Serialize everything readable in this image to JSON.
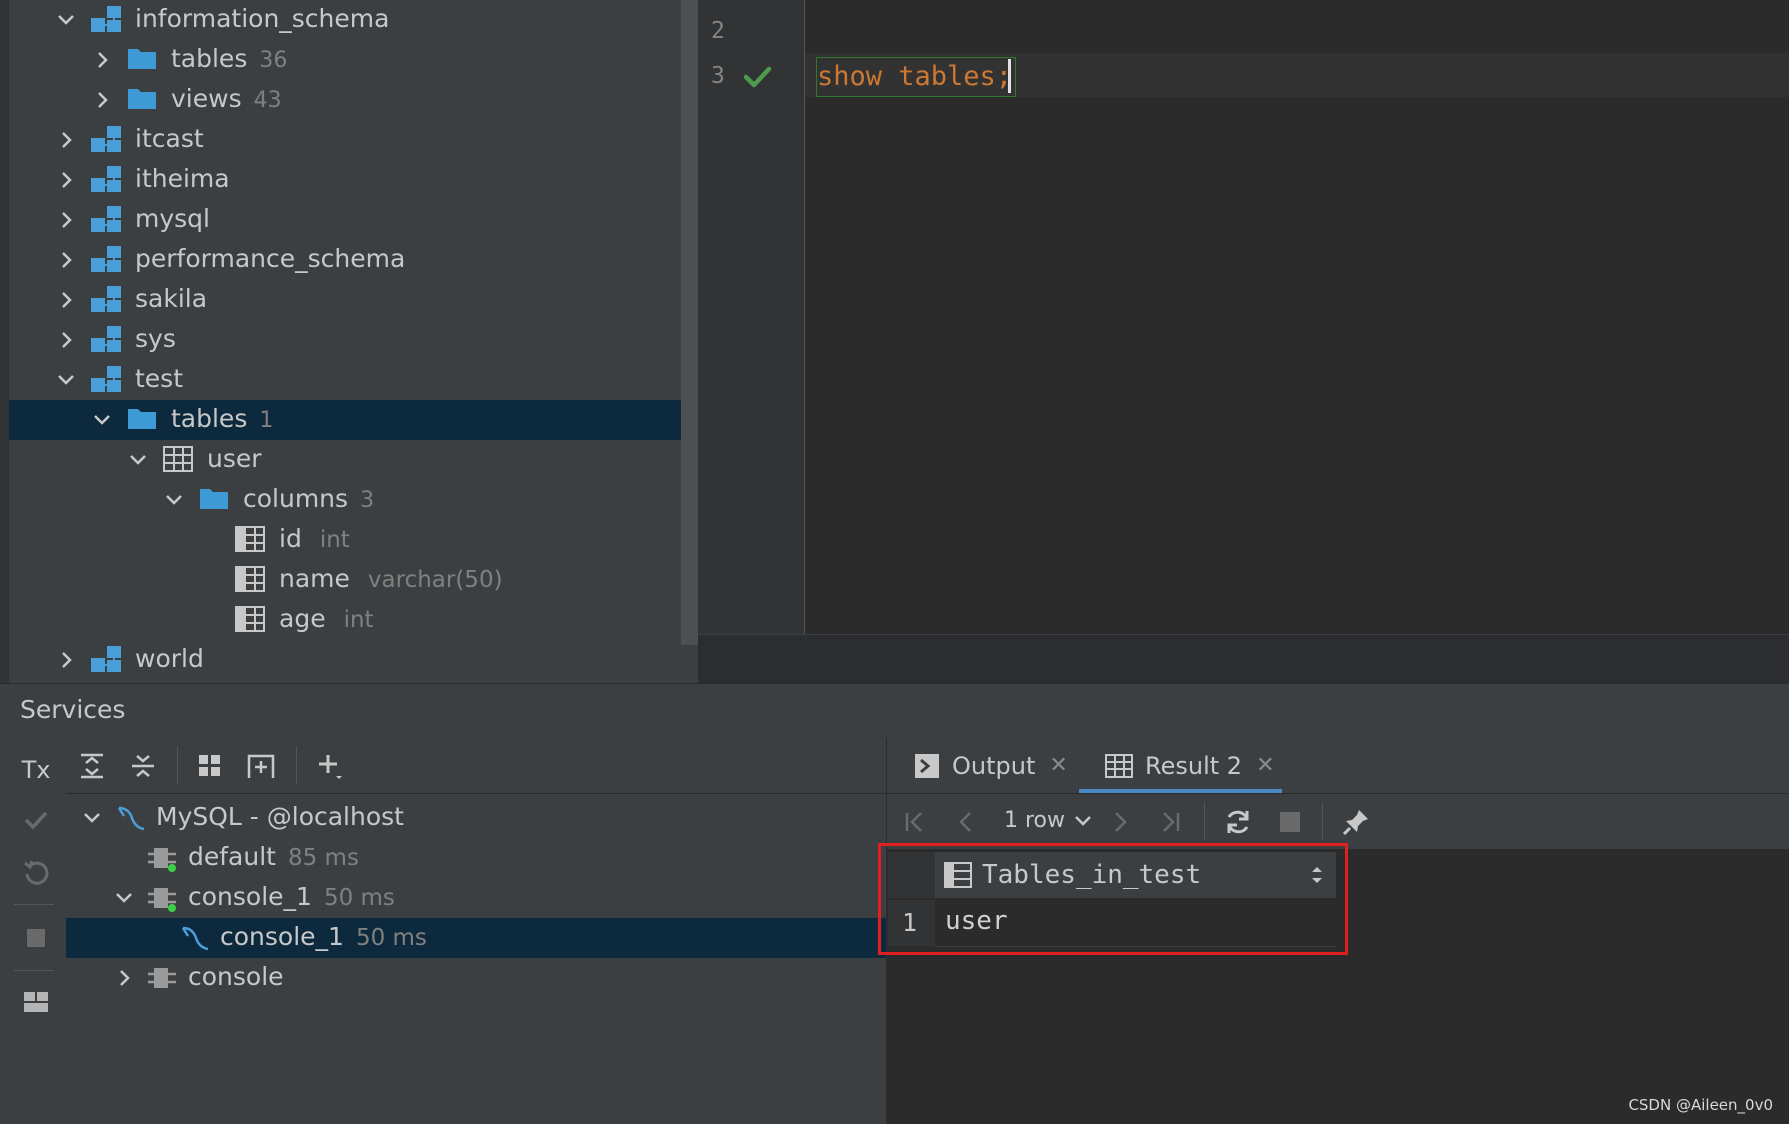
{
  "db_tree": {
    "items": [
      {
        "label": "information_schema",
        "count": "",
        "type": "",
        "kind": "schema",
        "expanded": true
      },
      {
        "label": "tables",
        "count": "36",
        "type": "",
        "kind": "folder",
        "expanded": false
      },
      {
        "label": "views",
        "count": "43",
        "type": "",
        "kind": "folder",
        "expanded": false
      },
      {
        "label": "itcast",
        "count": "",
        "type": "",
        "kind": "schema",
        "expanded": false
      },
      {
        "label": "itheima",
        "count": "",
        "type": "",
        "kind": "schema",
        "expanded": false
      },
      {
        "label": "mysql",
        "count": "",
        "type": "",
        "kind": "schema",
        "expanded": false
      },
      {
        "label": "performance_schema",
        "count": "",
        "type": "",
        "kind": "schema",
        "expanded": false
      },
      {
        "label": "sakila",
        "count": "",
        "type": "",
        "kind": "schema",
        "expanded": false
      },
      {
        "label": "sys",
        "count": "",
        "type": "",
        "kind": "schema",
        "expanded": false
      },
      {
        "label": "test",
        "count": "",
        "type": "",
        "kind": "schema",
        "expanded": true
      },
      {
        "label": "tables",
        "count": "1",
        "type": "",
        "kind": "folder",
        "expanded": true,
        "selected": true
      },
      {
        "label": "user",
        "count": "",
        "type": "",
        "kind": "table",
        "expanded": true
      },
      {
        "label": "columns",
        "count": "3",
        "type": "",
        "kind": "folder",
        "expanded": true
      },
      {
        "label": "id",
        "count": "",
        "type": "int",
        "kind": "column"
      },
      {
        "label": "name",
        "count": "",
        "type": "varchar(50)",
        "kind": "column"
      },
      {
        "label": "age",
        "count": "",
        "type": "int",
        "kind": "column"
      },
      {
        "label": "world",
        "count": "",
        "type": "",
        "kind": "schema",
        "expanded": false
      }
    ]
  },
  "editor": {
    "line_numbers": [
      "2",
      "3"
    ],
    "code": "show tables;",
    "status_icon": "checkmark-icon"
  },
  "services": {
    "title": "Services",
    "side_toolbar": [
      "Tx",
      "commit-icon",
      "rollback-icon",
      "stop-icon",
      "layout-icon"
    ],
    "toolbar_icons": [
      "expand-all-icon",
      "collapse-all-icon",
      "group-icon",
      "add-service-icon",
      "add-icon"
    ],
    "tree": [
      {
        "label": "MySQL - @localhost",
        "time": "",
        "kind": "datasource",
        "expanded": true
      },
      {
        "label": "default",
        "time": "85 ms",
        "kind": "session"
      },
      {
        "label": "console_1",
        "time": "50 ms",
        "kind": "session",
        "expanded": true
      },
      {
        "label": "console_1",
        "time": "50 ms",
        "kind": "console",
        "selected": true
      },
      {
        "label": "console",
        "time": "",
        "kind": "session",
        "expanded": false
      }
    ]
  },
  "result": {
    "tabs": [
      {
        "label": "Output",
        "active": false
      },
      {
        "label": "Result 2",
        "active": true
      }
    ],
    "row_count": "1 row",
    "column_header": "Tables_in_test",
    "rows": [
      {
        "num": "1",
        "value": "user"
      }
    ]
  },
  "colors": {
    "accent": "#4a88c7",
    "keyword": "#cc7832",
    "success": "#4e9a4e",
    "highlight_box": "#e02020"
  },
  "watermark": "CSDN @Aileen_0v0"
}
